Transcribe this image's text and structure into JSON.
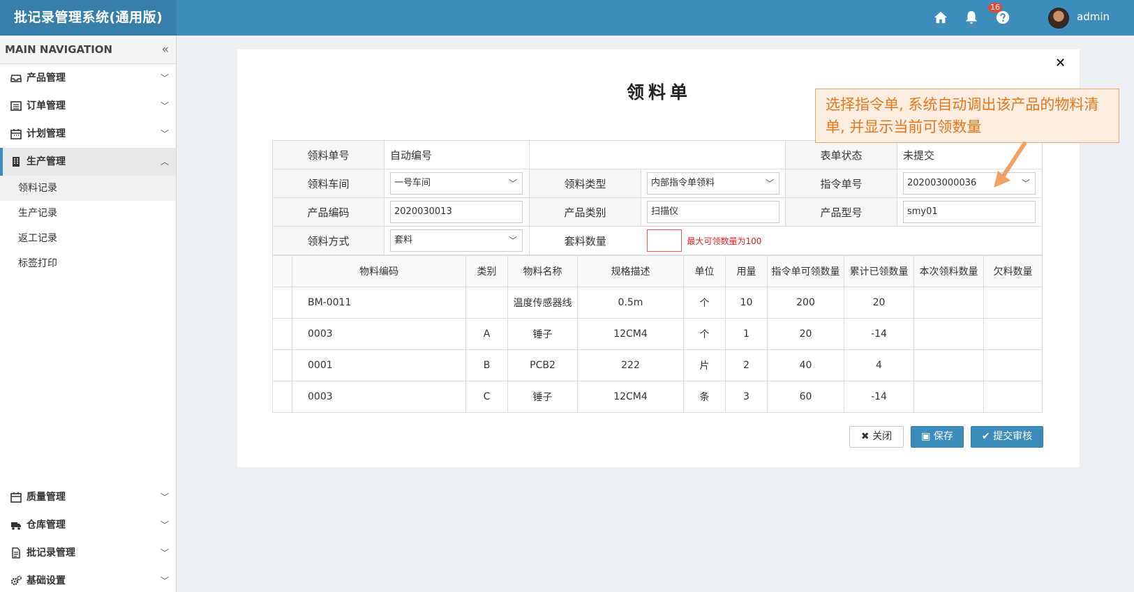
{
  "app": {
    "title": "批记录管理系统(通用版)"
  },
  "header": {
    "notification_count": "16",
    "username": "admin"
  },
  "sidebar": {
    "heading": "MAIN NAVIGATION",
    "items": [
      {
        "label": "产品管理"
      },
      {
        "label": "订单管理"
      },
      {
        "label": "计划管理"
      },
      {
        "label": "生产管理"
      }
    ],
    "sub_items": [
      {
        "label": "领料记录"
      },
      {
        "label": "生产记录"
      },
      {
        "label": "返工记录"
      },
      {
        "label": "标签打印"
      }
    ],
    "bottom_items": [
      {
        "label": "质量管理"
      },
      {
        "label": "仓库管理"
      },
      {
        "label": "批记录管理"
      },
      {
        "label": "基础设置"
      }
    ]
  },
  "form": {
    "title": "领料单",
    "callout": "选择指令单, 系统自动调出该产品的物料清单, 并显示当前可领数量",
    "labels": {
      "order_no": "领料单号",
      "status": "表单状态",
      "workshop": "领料车间",
      "type": "领料类型",
      "instruction_no": "指令单号",
      "product_code": "产品编码",
      "product_category": "产品类别",
      "product_model": "产品型号",
      "method": "领料方式",
      "kit_qty": "套料数量"
    },
    "values": {
      "order_no": "自动编号",
      "status": "未提交",
      "workshop": "一号车间",
      "type": "内部指令单领料",
      "instruction_no": "202003000036",
      "product_code": "2020030013",
      "product_category": "扫描仪",
      "product_model": "smy01",
      "method": "套料",
      "kit_qty": ""
    },
    "hint": "最大可领数量为100"
  },
  "table": {
    "headers": [
      "物料编码",
      "类别",
      "物料名称",
      "规格描述",
      "单位",
      "用量",
      "指令单可领数量",
      "累计已领数量",
      "本次领料数量",
      "欠料数量"
    ],
    "rows": [
      [
        "BM-0011",
        "",
        "温度传感器线",
        "0.5m",
        "个",
        "10",
        "200",
        "20",
        "",
        ""
      ],
      [
        "0003",
        "A",
        "锤子",
        "12CM4",
        "个",
        "1",
        "20",
        "-14",
        "",
        ""
      ],
      [
        "0001",
        "B",
        "PCB2",
        "222",
        "片",
        "2",
        "40",
        "4",
        "",
        ""
      ],
      [
        "0003",
        "C",
        "锤子",
        "12CM4",
        "条",
        "3",
        "60",
        "-14",
        "",
        ""
      ]
    ]
  },
  "buttons": {
    "close": "关闭",
    "save": "保存",
    "submit": "提交审核"
  },
  "colors": {
    "primary": "#3c8dbc",
    "brand_dark": "#367fa9",
    "callout_text": "#e8761b",
    "hint": "#e02020"
  }
}
